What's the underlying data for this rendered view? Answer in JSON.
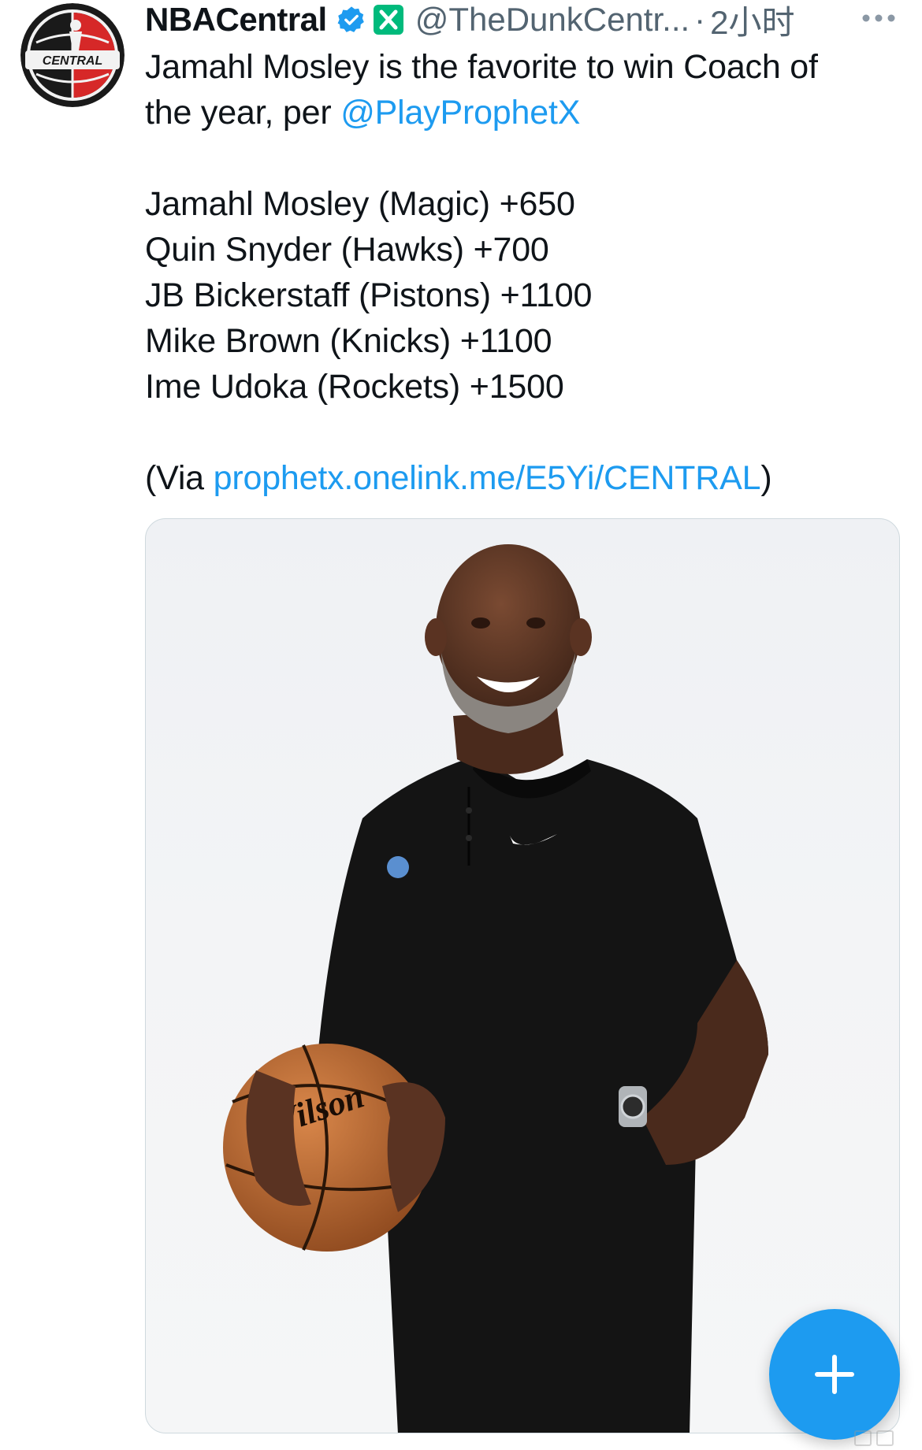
{
  "author": {
    "display_name": "NBACentral",
    "handle": "@TheDunkCentr...",
    "separator": "·",
    "timestamp": "2小时",
    "avatar_text": "CENTRAL",
    "avatar_icon": "nba-central-logo",
    "verified_icon": "verified-badge-icon",
    "affiliate_icon": "x-affiliate-badge-icon"
  },
  "tweet": {
    "line1": "Jamahl Mosley is the favorite to win Coach of",
    "line2_prefix": "the year, per ",
    "line2_mention": "@PlayProphetX",
    "odds": [
      "Jamahl Mosley (Magic) +650",
      "Quin Snyder (Hawks) +700",
      "JB Bickerstaff (Pistons) +1100",
      "Mike Brown (Knicks) +1100",
      "Ime Udoka (Rockets) +1500"
    ],
    "via_prefix": "(Via ",
    "via_link": "prophetx.onelink.me/E5Yi/CENTRAL",
    "via_suffix": ")"
  },
  "media": {
    "photo_subject": "coach-portrait-photo",
    "ball_brand": "Wilson"
  },
  "colors": {
    "link": "#1d9bf0",
    "text": "#0f1419",
    "secondary": "#536471",
    "fab": "#1d9bf0",
    "verified": "#1d9bf0",
    "affiliate": "#00ba7c"
  },
  "fab": {
    "icon": "plus-icon"
  }
}
